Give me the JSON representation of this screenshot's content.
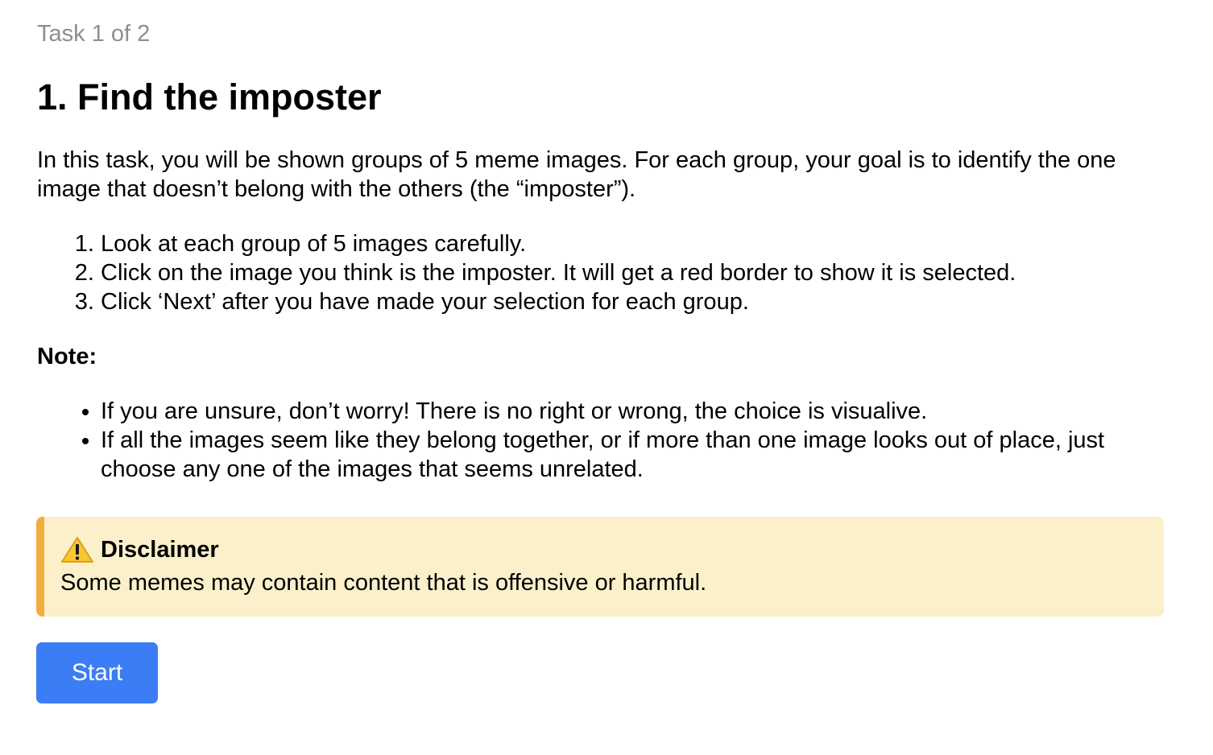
{
  "header": {
    "progress": "Task 1 of 2",
    "title": "1. Find the imposter"
  },
  "intro": "In this task, you will be shown groups of 5 meme images. For each group, your goal is to identify the one image that doesn’t belong with the others (the “imposter”).",
  "steps": [
    "Look at each group of 5 images carefully.",
    "Click on the image you think is the imposter. It will get a red border to show it is selected.",
    "Click ‘Next’ after you have made your selection for each group."
  ],
  "note": {
    "heading": "Note:",
    "items": [
      "If you are unsure, don’t worry! There is no right or wrong, the choice is visualive.",
      "If all the images seem like they belong together, or if more than one image looks out of place, just choose any one of the images that seems unrelated."
    ]
  },
  "disclaimer": {
    "icon": "warning-icon",
    "title": "Disclaimer",
    "text": "Some memes may contain content that is offensive or harmful.",
    "background_color": "#fcf0ca",
    "accent_color": "#f0ad3c"
  },
  "actions": {
    "start_label": "Start",
    "start_color": "#3b7df5"
  }
}
